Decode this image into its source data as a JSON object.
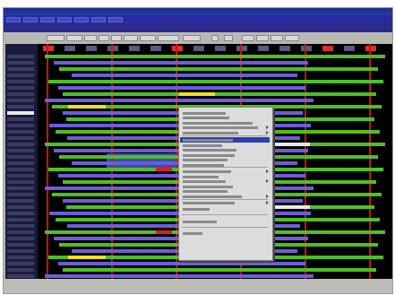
{
  "window": {
    "title": ""
  },
  "menubar": {
    "items": [
      "",
      "",
      "",
      "",
      "",
      "",
      ""
    ]
  },
  "toolbar": {
    "info_text": ""
  },
  "colors": {
    "menubar_bg": "#2a2aa0",
    "grid_bg": "#000000",
    "divider_red": "#cc1010",
    "bar_green": "#4ec022",
    "bar_purple": "#6a5fd8",
    "bar_yellow": "#f2e21a",
    "bar_red": "#d82020",
    "bar_white": "#e8e8e8",
    "selection_blue": "#4858c8"
  },
  "context_menu": {
    "items": [
      "",
      "",
      "",
      "",
      "",
      "",
      "",
      "",
      "",
      "",
      "",
      "",
      "",
      "",
      "",
      "",
      "",
      "",
      "",
      "",
      ""
    ]
  }
}
